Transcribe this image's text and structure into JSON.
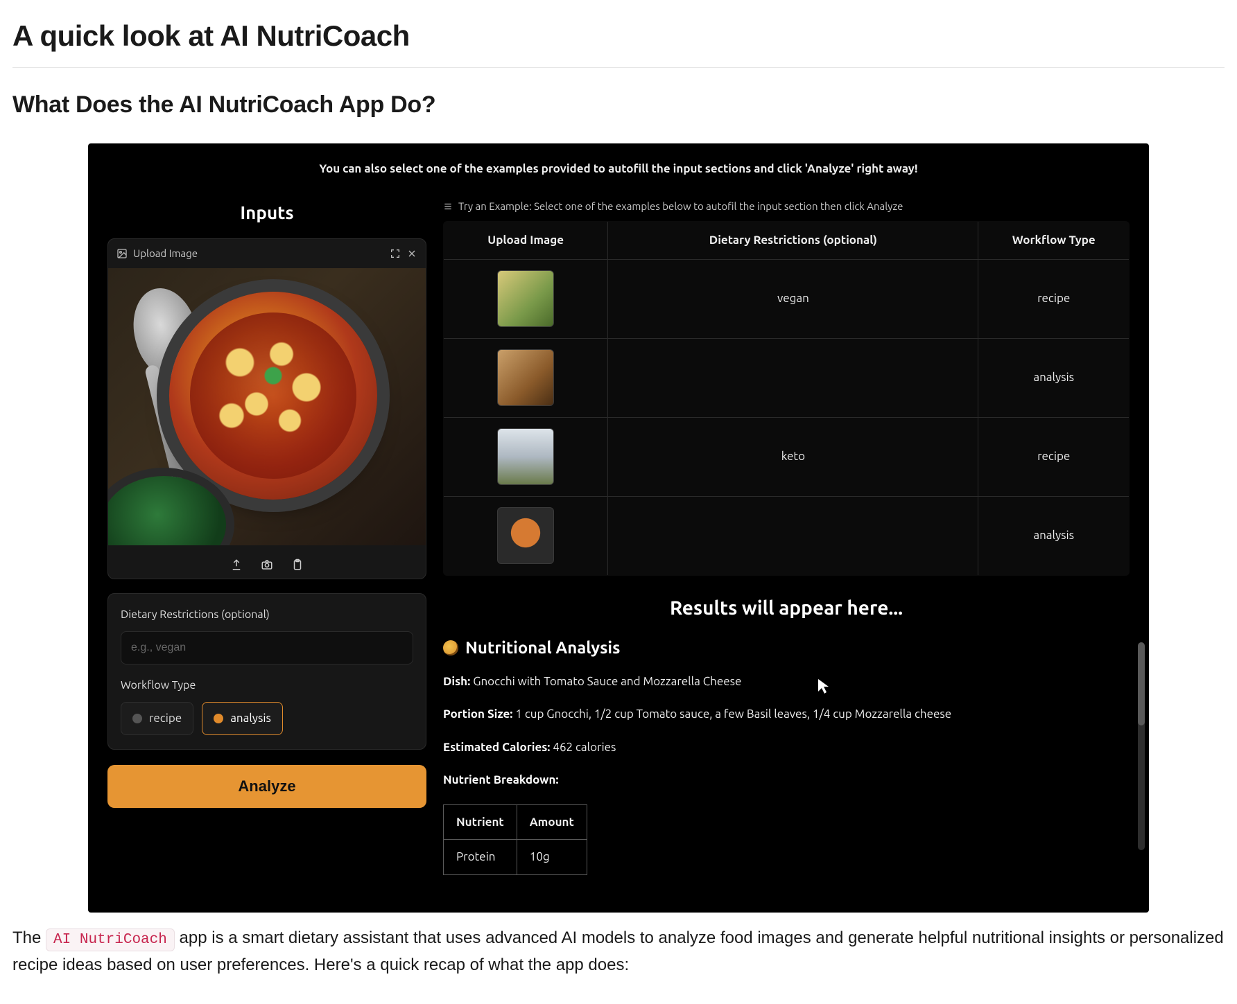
{
  "page": {
    "title": "A quick look at AI NutriCoach",
    "section_heading": "What Does the AI NutriCoach App Do?",
    "para_before": "The ",
    "para_code": "AI NutriCoach",
    "para_after": " app is a smart dietary assistant that uses advanced AI models to analyze food images and generate helpful nutritional insights or personalized recipe ideas based on user preferences. Here's a quick recap of what the app does:"
  },
  "app": {
    "tip": "You can also select one of the examples provided to autofill the input sections and click 'Analyze' right away!",
    "inputs_heading": "Inputs",
    "upload_label": "Upload Image",
    "dietary_label": "Dietary Restrictions (optional)",
    "dietary_placeholder": "e.g., vegan",
    "workflow_label": "Workflow Type",
    "workflow_options": {
      "recipe": "recipe",
      "analysis": "analysis"
    },
    "workflow_selected": "analysis",
    "analyze_label": "Analyze",
    "example_hint": "Try an Example: Select one of the examples below to autofil the input section then click Analyze",
    "example_headers": {
      "img": "Upload Image",
      "diet": "Dietary Restrictions (optional)",
      "wf": "Workflow Type"
    },
    "examples": [
      {
        "diet": "vegan",
        "wf": "recipe"
      },
      {
        "diet": "",
        "wf": "analysis"
      },
      {
        "diet": "keto",
        "wf": "recipe"
      },
      {
        "diet": "",
        "wf": "analysis"
      }
    ],
    "results_heading": "Results will appear here...",
    "analysis": {
      "title": "Nutritional Analysis",
      "dish_label": "Dish:",
      "dish": "Gnocchi with Tomato Sauce and Mozzarella Cheese",
      "portion_label": "Portion Size:",
      "portion": "1 cup Gnocchi, 1/2 cup Tomato sauce, a few Basil leaves, 1/4 cup Mozzarella cheese",
      "cal_label": "Estimated Calories:",
      "cal": "462 calories",
      "breakdown_label": "Nutrient Breakdown:",
      "table_head": {
        "c1": "Nutrient",
        "c2": "Amount"
      },
      "rows": [
        {
          "c1": "Protein",
          "c2": "10g"
        }
      ]
    }
  }
}
